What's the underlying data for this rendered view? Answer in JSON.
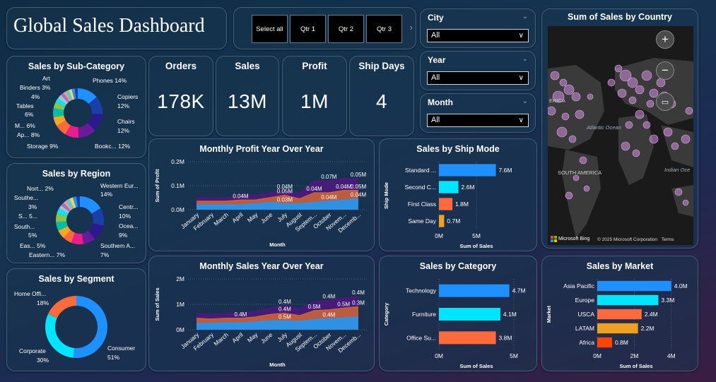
{
  "title": "Global Sales Dashboard",
  "nav_buttons": [
    "Select all",
    "Qtr 1",
    "Qtr 2",
    "Qtr 3"
  ],
  "slicers": [
    {
      "label": "City",
      "value": "All"
    },
    {
      "label": "Year",
      "value": "All"
    },
    {
      "label": "Month",
      "value": "All"
    }
  ],
  "kpis": [
    {
      "label": "Orders",
      "value": "178K"
    },
    {
      "label": "Sales",
      "value": "13M"
    },
    {
      "label": "Profit",
      "value": "1M"
    },
    {
      "label": "Ship Days",
      "value": "4"
    }
  ],
  "subcategory": {
    "title": "Sales by Sub-Category",
    "labels": [
      "Art",
      "Binders 3%",
      "4%",
      "Tables",
      "6%",
      "M... 6%",
      "Ap... 8%",
      "Storage 9%",
      "Phones 14%",
      "Copiers",
      "12%",
      "Chairs",
      "12%",
      "Bookc... 12%"
    ]
  },
  "region": {
    "title": "Sales by Region",
    "labels": [
      "Nort... 2%",
      "Southe...",
      "3%",
      "S... 5...",
      "South...",
      "5%",
      "Eas... 5%",
      "Eastern... 7%",
      "Western Eur...",
      "14%",
      "Centr...",
      "10%",
      "Ocea...",
      "9%",
      "Southern A...",
      "7%"
    ]
  },
  "segment": {
    "title": "Sales by Segment",
    "labels": [
      "Home Offi...",
      "18%",
      "Corporate",
      "30%",
      "Consumer",
      "51%"
    ]
  },
  "map": {
    "title": "Sum of Sales by Country",
    "labels": [
      "ERICA",
      "Atlantic Ocean",
      "SOUTH AMERICA",
      "Indian Oce"
    ],
    "attribution": "Microsoft Bing",
    "copyright": "© 2025 Microsoft Corporation",
    "terms": "Terms"
  },
  "chart_data": [
    {
      "type": "area",
      "title": "Monthly Profit Year Over Year",
      "xlabel": "Month",
      "ylabel": "Sum of Profit",
      "categories": [
        "January",
        "February",
        "March",
        "April",
        "May",
        "June",
        "July",
        "August",
        "Septem...",
        "October",
        "Novem...",
        "Decemb..."
      ],
      "yticks": [
        "0.0M",
        "0.1M",
        "0.2M"
      ],
      "ylim": [
        0,
        0.2
      ],
      "series": [
        {
          "color": "#4b1a7a",
          "values": [
            0.05,
            0.05,
            0.05,
            0.06,
            0.06,
            0.07,
            0.08,
            0.07,
            0.12,
            0.12,
            0.13,
            0.13
          ]
        },
        {
          "color": "#c8643c",
          "values": [
            0.035,
            0.035,
            0.035,
            0.04,
            0.04,
            0.05,
            0.06,
            0.045,
            0.07,
            0.07,
            0.08,
            0.08
          ]
        },
        {
          "color": "#2196f3",
          "values": [
            0.02,
            0.02,
            0.02,
            0.02,
            0.025,
            0.03,
            0.025,
            0.025,
            0.03,
            0.035,
            0.04,
            0.045
          ]
        }
      ],
      "data_labels": [
        "0.04M",
        "0.04M",
        "0.05M",
        "0.03M",
        "0.04M",
        "0.04M",
        "0.07M",
        "0.04M",
        "0.05M",
        "0.05M",
        "0.04M"
      ]
    },
    {
      "type": "area",
      "title": "Monthly Sales Year Over Year",
      "xlabel": "Month",
      "ylabel": "Sum of Sales",
      "categories": [
        "January",
        "February",
        "March",
        "April",
        "May",
        "June",
        "July",
        "August",
        "Septem...",
        "October",
        "Novem...",
        "Decemb..."
      ],
      "yticks": [
        "0M",
        "1M",
        "2M"
      ],
      "ylim": [
        0,
        2
      ],
      "series": [
        {
          "color": "#4b1a7a",
          "values": [
            0.65,
            0.6,
            0.65,
            0.65,
            0.72,
            0.85,
            0.95,
            0.82,
            1.1,
            1.15,
            1.25,
            1.3
          ]
        },
        {
          "color": "#c8643c",
          "values": [
            0.45,
            0.42,
            0.45,
            0.45,
            0.5,
            0.6,
            0.65,
            0.55,
            0.75,
            0.78,
            0.85,
            0.9
          ]
        },
        {
          "color": "#2196f3",
          "values": [
            0.25,
            0.25,
            0.27,
            0.27,
            0.3,
            0.35,
            0.35,
            0.33,
            0.4,
            0.43,
            0.46,
            0.5
          ]
        }
      ],
      "data_labels": [
        "0.4M",
        "0.4M",
        "0.4M",
        "0.5M",
        "0.5M",
        "0.4M",
        "0.4M",
        "0.5M",
        "0.4M",
        "0.3M"
      ]
    },
    {
      "type": "bar",
      "title": "Sales by Ship Mode",
      "xlabel": "Sum of Sales",
      "ylabel": "Ship Mode",
      "categories": [
        "Standard ...",
        "Second C...",
        "First Class",
        "Same Day"
      ],
      "values": [
        7.6,
        2.6,
        1.8,
        0.7
      ],
      "value_labels": [
        "7.6M",
        "2.6M",
        "1.8M",
        "0.7M"
      ],
      "colors": [
        "#1e90ff",
        "#00e5ff",
        "#ff6a3d",
        "#f0a020"
      ],
      "xticks": [
        "0M",
        "5M"
      ],
      "xlim": [
        0,
        10
      ]
    },
    {
      "type": "bar",
      "title": "Sales by Category",
      "xlabel": "Sum of Sales",
      "ylabel": "Category",
      "categories": [
        "Technology",
        "Furniture",
        "Office Su..."
      ],
      "values": [
        4.7,
        4.1,
        3.8
      ],
      "value_labels": [
        "4.7M",
        "4.1M",
        "3.8M"
      ],
      "colors": [
        "#1e90ff",
        "#00e5ff",
        "#ff6a3d"
      ],
      "xticks": [
        "0M",
        "5M"
      ],
      "xlim": [
        0,
        5
      ]
    },
    {
      "type": "bar",
      "title": "Sales by Market",
      "xlabel": "Sum of Sales",
      "ylabel": "Market",
      "categories": [
        "Asia Pacific",
        "Europe",
        "USCA",
        "LATAM",
        "Africa"
      ],
      "values": [
        4.0,
        3.3,
        2.4,
        2.2,
        0.8
      ],
      "value_labels": [
        "4.0M",
        "3.3M",
        "2.4M",
        "2.2M",
        "0.8M"
      ],
      "colors": [
        "#1e90ff",
        "#00e5ff",
        "#ff6a3d",
        "#f0a020",
        "#ff4500"
      ],
      "xticks": [
        "0M",
        "2M",
        "4M"
      ],
      "xlim": [
        0,
        4.2
      ]
    },
    {
      "type": "pie",
      "title": "Sales by Segment",
      "categories": [
        "Consumer",
        "Corporate",
        "Home Office"
      ],
      "values": [
        51,
        30,
        18
      ],
      "colors": [
        "#1e90ff",
        "#00e5ff",
        "#ff6a3d"
      ]
    }
  ]
}
